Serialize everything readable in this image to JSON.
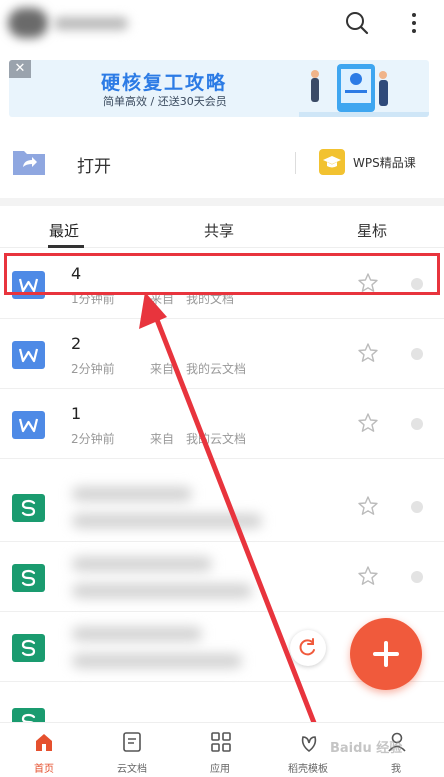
{
  "banner": {
    "title": "硬核复工攻略",
    "subtitle": "简单高效 / 还送30天会员",
    "close": "✕"
  },
  "quick_actions": {
    "open_label": "打开",
    "wps_course_label": "WPS精品课"
  },
  "tabs": [
    {
      "label": "最近",
      "active": true
    },
    {
      "label": "共享",
      "active": false
    },
    {
      "label": "星标",
      "active": false
    }
  ],
  "files": [
    {
      "name": "4",
      "time": "1分钟前",
      "from": "来自",
      "location": "我的文档",
      "type": "W"
    },
    {
      "name": "2",
      "time": "2分钟前",
      "from": "来自",
      "location": "我的云文档",
      "type": "W"
    },
    {
      "name": "1",
      "time": "2分钟前",
      "from": "来自",
      "location": "我的云文档",
      "type": "W"
    }
  ],
  "blurred_file_types": [
    "S",
    "S",
    "S"
  ],
  "bottom_nav": [
    {
      "label": "首页",
      "active": true
    },
    {
      "label": "云文档",
      "active": false
    },
    {
      "label": "应用",
      "active": false
    },
    {
      "label": "稻壳模板",
      "active": false
    },
    {
      "label": "我",
      "active": false
    }
  ],
  "watermark": "Baidu 经验",
  "colors": {
    "accent": "#f05a3c",
    "highlight": "#e8343d",
    "writer_blue": "#4e8ae6",
    "sheet_green": "#1a9b6f"
  }
}
